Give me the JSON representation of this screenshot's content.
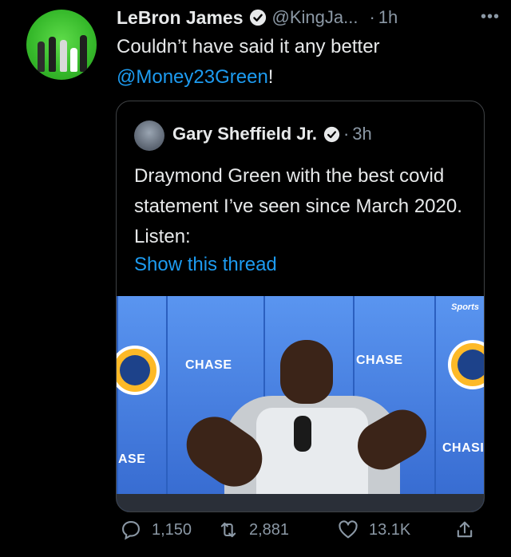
{
  "tweet": {
    "author_name": "LeBron James",
    "handle": "@KingJa...",
    "separator": "·",
    "time": "1h",
    "more": "•••",
    "text_before": "Couldn’t have said it any better",
    "mention": "@Money23Green",
    "text_after": "!"
  },
  "quote": {
    "author_name": "Gary Sheffield Jr.",
    "separator": "·",
    "time": "3h",
    "text": "Draymond Green with the best covid statement I’ve seen since March 2020. Listen:",
    "show_thread": "Show this thread",
    "media": {
      "chase_1": "CHASE",
      "chase_2": "CHASE",
      "chase_3": "ASE",
      "chase_4": "CHASI",
      "sports_badge": "Sports"
    }
  },
  "actions": {
    "replies": "1,150",
    "retweets": "2,881",
    "likes": "13.1K"
  },
  "colors": {
    "accent": "#1d9bf0",
    "muted": "#8b98a5",
    "text": "#e7e9ea",
    "background": "#000000"
  },
  "icons": [
    "verified-badge-icon",
    "more-icon",
    "reply-icon",
    "retweet-icon",
    "like-icon",
    "share-icon"
  ]
}
